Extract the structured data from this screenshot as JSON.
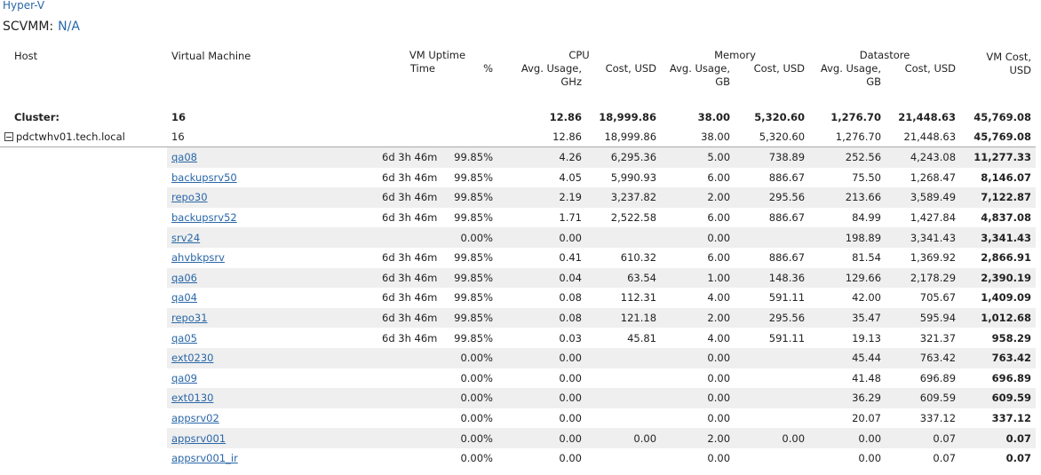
{
  "breadcrumb": "Hyper-V",
  "scvmm_label": "SCVMM:",
  "scvmm_value": "N/A",
  "groups": {
    "uptime": "VM Uptime",
    "cpu": "CPU",
    "memory": "Memory",
    "datastore": "Datastore"
  },
  "columns": {
    "host": "Host",
    "vm": "Virtual Machine",
    "time": "Time",
    "pct": "%",
    "cpu_usage_1": "Avg. Usage,",
    "cpu_usage_2": "GHz",
    "cpu_cost": "Cost, USD",
    "mem_usage_1": "Avg. Usage,",
    "mem_usage_2": "GB",
    "mem_cost": "Cost, USD",
    "ds_usage_1": "Avg. Usage,",
    "ds_usage_2": "GB",
    "ds_cost": "Cost, USD",
    "vm_cost_1": "VM Cost,",
    "vm_cost_2": "USD"
  },
  "cluster": {
    "label": "Cluster:",
    "vm_count": "16",
    "cpu_usage": "12.86",
    "cpu_cost": "18,999.86",
    "mem_usage": "38.00",
    "mem_cost": "5,320.60",
    "ds_usage": "1,276.70",
    "ds_cost": "21,448.63",
    "vm_cost": "45,769.08"
  },
  "host": {
    "name": "pdctwhv01.tech.local",
    "vm_count": "16",
    "cpu_usage": "12.86",
    "cpu_cost": "18,999.86",
    "mem_usage": "38.00",
    "mem_cost": "5,320.60",
    "ds_usage": "1,276.70",
    "ds_cost": "21,448.63",
    "vm_cost": "45,769.08"
  },
  "vms": [
    {
      "name": "qa08",
      "time": "6d 3h 46m",
      "pct": "99.85%",
      "cpu_usage": "4.26",
      "cpu_cost": "6,295.36",
      "mem_usage": "5.00",
      "mem_cost": "738.89",
      "ds_usage": "252.56",
      "ds_cost": "4,243.08",
      "vm_cost": "11,277.33"
    },
    {
      "name": "backupsrv50",
      "time": "6d 3h 46m",
      "pct": "99.85%",
      "cpu_usage": "4.05",
      "cpu_cost": "5,990.93",
      "mem_usage": "6.00",
      "mem_cost": "886.67",
      "ds_usage": "75.50",
      "ds_cost": "1,268.47",
      "vm_cost": "8,146.07"
    },
    {
      "name": "repo30",
      "time": "6d 3h 46m",
      "pct": "99.85%",
      "cpu_usage": "2.19",
      "cpu_cost": "3,237.82",
      "mem_usage": "2.00",
      "mem_cost": "295.56",
      "ds_usage": "213.66",
      "ds_cost": "3,589.49",
      "vm_cost": "7,122.87"
    },
    {
      "name": "backupsrv52",
      "time": "6d 3h 46m",
      "pct": "99.85%",
      "cpu_usage": "1.71",
      "cpu_cost": "2,522.58",
      "mem_usage": "6.00",
      "mem_cost": "886.67",
      "ds_usage": "84.99",
      "ds_cost": "1,427.84",
      "vm_cost": "4,837.08"
    },
    {
      "name": "srv24",
      "time": "",
      "pct": "0.00%",
      "cpu_usage": "0.00",
      "cpu_cost": "",
      "mem_usage": "0.00",
      "mem_cost": "",
      "ds_usage": "198.89",
      "ds_cost": "3,341.43",
      "vm_cost": "3,341.43"
    },
    {
      "name": "ahvbkpsrv",
      "time": "6d 3h 46m",
      "pct": "99.85%",
      "cpu_usage": "0.41",
      "cpu_cost": "610.32",
      "mem_usage": "6.00",
      "mem_cost": "886.67",
      "ds_usage": "81.54",
      "ds_cost": "1,369.92",
      "vm_cost": "2,866.91"
    },
    {
      "name": "qa06",
      "time": "6d 3h 46m",
      "pct": "99.85%",
      "cpu_usage": "0.04",
      "cpu_cost": "63.54",
      "mem_usage": "1.00",
      "mem_cost": "148.36",
      "ds_usage": "129.66",
      "ds_cost": "2,178.29",
      "vm_cost": "2,390.19"
    },
    {
      "name": "qa04",
      "time": "6d 3h 46m",
      "pct": "99.85%",
      "cpu_usage": "0.08",
      "cpu_cost": "112.31",
      "mem_usage": "4.00",
      "mem_cost": "591.11",
      "ds_usage": "42.00",
      "ds_cost": "705.67",
      "vm_cost": "1,409.09"
    },
    {
      "name": "repo31",
      "time": "6d 3h 46m",
      "pct": "99.85%",
      "cpu_usage": "0.08",
      "cpu_cost": "121.18",
      "mem_usage": "2.00",
      "mem_cost": "295.56",
      "ds_usage": "35.47",
      "ds_cost": "595.94",
      "vm_cost": "1,012.68"
    },
    {
      "name": "qa05",
      "time": "6d 3h 46m",
      "pct": "99.85%",
      "cpu_usage": "0.03",
      "cpu_cost": "45.81",
      "mem_usage": "4.00",
      "mem_cost": "591.11",
      "ds_usage": "19.13",
      "ds_cost": "321.37",
      "vm_cost": "958.29"
    },
    {
      "name": "ext0230",
      "time": "",
      "pct": "0.00%",
      "cpu_usage": "0.00",
      "cpu_cost": "",
      "mem_usage": "0.00",
      "mem_cost": "",
      "ds_usage": "45.44",
      "ds_cost": "763.42",
      "vm_cost": "763.42"
    },
    {
      "name": "qa09",
      "time": "",
      "pct": "0.00%",
      "cpu_usage": "0.00",
      "cpu_cost": "",
      "mem_usage": "0.00",
      "mem_cost": "",
      "ds_usage": "41.48",
      "ds_cost": "696.89",
      "vm_cost": "696.89"
    },
    {
      "name": "ext0130",
      "time": "",
      "pct": "0.00%",
      "cpu_usage": "0.00",
      "cpu_cost": "",
      "mem_usage": "0.00",
      "mem_cost": "",
      "ds_usage": "36.29",
      "ds_cost": "609.59",
      "vm_cost": "609.59"
    },
    {
      "name": "appsrv02",
      "time": "",
      "pct": "0.00%",
      "cpu_usage": "0.00",
      "cpu_cost": "",
      "mem_usage": "0.00",
      "mem_cost": "",
      "ds_usage": "20.07",
      "ds_cost": "337.12",
      "vm_cost": "337.12"
    },
    {
      "name": "appsrv001",
      "time": "",
      "pct": "0.00%",
      "cpu_usage": "0.00",
      "cpu_cost": "0.00",
      "mem_usage": "2.00",
      "mem_cost": "0.00",
      "ds_usage": "0.00",
      "ds_cost": "0.07",
      "vm_cost": "0.07"
    },
    {
      "name": "appsrv001_ir",
      "time": "",
      "pct": "0.00%",
      "cpu_usage": "0.00",
      "cpu_cost": "",
      "mem_usage": "0.00",
      "mem_cost": "",
      "ds_usage": "0.00",
      "ds_cost": "0.07",
      "vm_cost": "0.07"
    }
  ]
}
